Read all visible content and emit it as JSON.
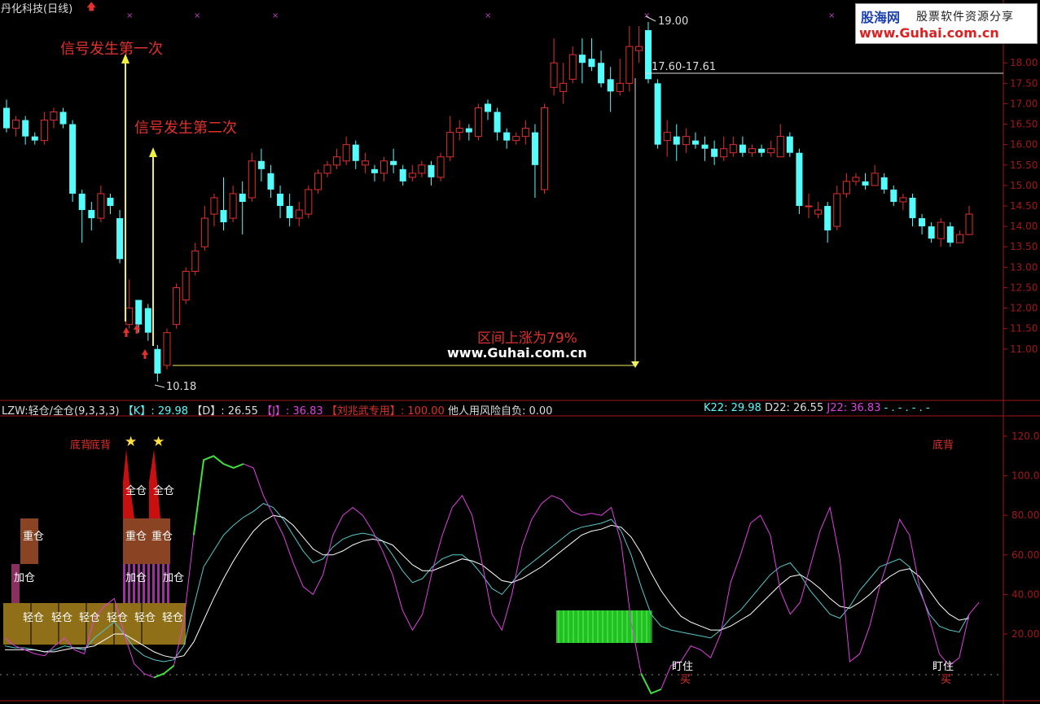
{
  "window": {
    "title": "丹化科技(日线)"
  },
  "logo": {
    "line1_brand": "股海网",
    "line1_text": "股票软件资源分享",
    "line2": "www.Guhai.com.cn"
  },
  "annotations": {
    "signal1": "信号发生第一次",
    "signal2": "信号发生第二次",
    "range_rise": "区间上涨为79%",
    "watermark": "www.Guhai.com.cn",
    "high_label": "19.00",
    "low_label": "10.18",
    "range_label": "17.60-17.61"
  },
  "indicator": {
    "name": "LZW:轻仓/全仓(9,3,3,3)",
    "k_label": "【K】",
    "k_value": ": 29.98",
    "d_label": "【D】",
    "d_value": ": 26.55",
    "j_label": "【J】",
    "j_value": ": 36.83",
    "liu_label": "【刘兆武专用】",
    "liu_value": ": 100.00",
    "risk": "他人用风险自负: 0.00",
    "k22": "K22: 29.98",
    "d22": "D22: 26.55",
    "j22": "J22: 36.83",
    "tail": "- . - . - . -"
  },
  "labels": {
    "bottom_divergence_left": "底背",
    "bottom_divergence_right": "底背",
    "star": "★",
    "full": "全仓",
    "heavy": "重仓",
    "add": "加仓",
    "light": "轻仓",
    "watch": "盯住",
    "buy": "买"
  },
  "colors": {
    "up": "#e0312c",
    "down": "#54fcfc",
    "axis": "#a01818",
    "k_line": "#54c8c8",
    "d_line": "#ffffff",
    "j_line": "#e040e0",
    "j_green": "#40e040",
    "light_block": "#8f7018",
    "heavy_block": "#8a4424",
    "full_spike": "#c81010",
    "green_block": "#20c020"
  },
  "chart_data": [
    {
      "type": "candlestick",
      "title": "丹化科技(日线)",
      "y_axis_ticks": [
        11.0,
        11.5,
        12.0,
        12.5,
        13.0,
        13.5,
        14.0,
        14.5,
        15.0,
        15.5,
        16.0,
        16.5,
        17.0,
        17.5,
        18.0
      ],
      "ylim": [
        10.2,
        19.1
      ],
      "candles": [
        [
          16.9,
          16.4,
          17.1,
          16.3
        ],
        [
          16.4,
          16.6,
          16.7,
          16.2
        ],
        [
          16.6,
          16.2,
          16.7,
          16.0
        ],
        [
          16.2,
          16.1,
          16.3,
          16.0
        ],
        [
          16.1,
          16.6,
          16.8,
          16.0
        ],
        [
          16.6,
          16.8,
          16.9,
          16.4
        ],
        [
          16.8,
          16.5,
          16.9,
          16.4
        ],
        [
          16.5,
          14.8,
          16.6,
          14.6
        ],
        [
          14.8,
          14.4,
          14.9,
          13.6
        ],
        [
          14.4,
          14.2,
          14.6,
          13.9
        ],
        [
          14.2,
          14.8,
          15.0,
          14.1
        ],
        [
          14.7,
          14.5,
          14.8,
          14.3
        ],
        [
          14.2,
          13.2,
          14.4,
          13.1
        ],
        [
          11.6,
          12.0,
          12.7,
          11.5
        ],
        [
          12.2,
          11.6,
          12.2,
          11.4
        ],
        [
          12.0,
          11.4,
          12.1,
          11.2
        ],
        [
          11.0,
          10.4,
          11.1,
          10.2
        ],
        [
          10.6,
          11.4,
          11.5,
          10.5
        ],
        [
          11.6,
          12.5,
          12.6,
          11.5
        ],
        [
          12.2,
          12.9,
          13.0,
          12.1
        ],
        [
          12.9,
          13.4,
          13.6,
          12.8
        ],
        [
          13.5,
          14.2,
          14.5,
          13.4
        ],
        [
          14.3,
          14.7,
          14.8,
          14.0
        ],
        [
          14.4,
          14.1,
          15.2,
          13.9
        ],
        [
          14.2,
          14.8,
          15.0,
          14.1
        ],
        [
          14.8,
          14.6,
          15.1,
          13.8
        ],
        [
          14.7,
          15.6,
          15.8,
          14.6
        ],
        [
          15.6,
          15.4,
          15.9,
          15.1
        ],
        [
          15.3,
          14.9,
          15.5,
          14.7
        ],
        [
          14.8,
          14.5,
          15.0,
          14.2
        ],
        [
          14.5,
          14.2,
          14.8,
          14.0
        ],
        [
          14.2,
          14.4,
          14.6,
          14.0
        ],
        [
          14.3,
          14.9,
          15.0,
          14.2
        ],
        [
          14.9,
          15.3,
          15.4,
          14.8
        ],
        [
          15.3,
          15.5,
          15.6,
          15.2
        ],
        [
          15.5,
          15.7,
          15.9,
          15.4
        ],
        [
          15.6,
          16.0,
          16.2,
          15.5
        ],
        [
          16.0,
          15.6,
          16.1,
          15.4
        ],
        [
          15.5,
          15.6,
          15.8,
          15.3
        ],
        [
          15.4,
          15.3,
          15.5,
          15.1
        ],
        [
          15.3,
          15.6,
          15.7,
          15.1
        ],
        [
          15.6,
          15.5,
          15.9,
          15.3
        ],
        [
          15.4,
          15.1,
          15.5,
          15.0
        ],
        [
          15.2,
          15.3,
          15.5,
          15.1
        ],
        [
          15.3,
          15.5,
          15.6,
          15.2
        ],
        [
          15.5,
          15.2,
          15.6,
          15.0
        ],
        [
          15.2,
          15.7,
          15.8,
          15.1
        ],
        [
          15.7,
          16.3,
          16.7,
          15.6
        ],
        [
          16.3,
          16.4,
          16.6,
          16.1
        ],
        [
          16.4,
          16.3,
          16.5,
          16.1
        ],
        [
          16.2,
          16.9,
          17.0,
          16.1
        ],
        [
          17.0,
          16.8,
          17.1,
          16.6
        ],
        [
          16.8,
          16.3,
          16.9,
          16.1
        ],
        [
          16.3,
          16.1,
          16.4,
          15.9
        ],
        [
          16.1,
          16.2,
          16.3,
          16.0
        ],
        [
          16.2,
          16.4,
          16.6,
          16.0
        ],
        [
          16.3,
          15.5,
          16.5,
          14.7
        ],
        [
          14.9,
          16.9,
          17.0,
          14.8
        ],
        [
          17.4,
          18.0,
          18.6,
          17.2
        ],
        [
          17.3,
          17.5,
          18.0,
          17.0
        ],
        [
          17.6,
          18.2,
          18.4,
          17.5
        ],
        [
          18.2,
          18.0,
          18.6,
          17.5
        ],
        [
          18.1,
          17.9,
          18.6,
          17.8
        ],
        [
          18.0,
          17.5,
          18.3,
          17.4
        ],
        [
          17.6,
          17.3,
          17.9,
          16.8
        ],
        [
          17.3,
          17.5,
          18.1,
          17.2
        ],
        [
          17.5,
          18.4,
          18.9,
          17.3
        ],
        [
          18.3,
          18.4,
          18.9,
          18.0
        ],
        [
          18.8,
          17.6,
          19.0,
          17.5
        ],
        [
          17.5,
          16.0,
          17.6,
          15.9
        ],
        [
          16.1,
          16.3,
          16.6,
          15.7
        ],
        [
          16.2,
          16.0,
          16.5,
          15.6
        ],
        [
          16.0,
          16.2,
          16.4,
          15.8
        ],
        [
          16.1,
          16.0,
          16.3,
          15.9
        ],
        [
          16.0,
          15.9,
          16.2,
          15.6
        ],
        [
          15.9,
          15.7,
          16.1,
          15.5
        ],
        [
          15.7,
          15.9,
          16.2,
          15.6
        ],
        [
          15.8,
          16.0,
          16.2,
          15.7
        ],
        [
          16.0,
          15.8,
          16.2,
          15.7
        ],
        [
          15.8,
          15.9,
          16.0,
          15.7
        ],
        [
          15.9,
          15.8,
          16.0,
          15.7
        ],
        [
          15.8,
          15.9,
          16.1,
          15.7
        ],
        [
          15.7,
          16.2,
          16.5,
          15.7
        ],
        [
          16.2,
          15.8,
          16.3,
          15.7
        ],
        [
          15.8,
          14.5,
          15.9,
          14.3
        ],
        [
          14.5,
          14.5,
          14.8,
          14.2
        ],
        [
          14.3,
          14.4,
          14.6,
          14.2
        ],
        [
          14.5,
          13.9,
          14.6,
          13.6
        ],
        [
          14.0,
          14.8,
          15.0,
          13.9
        ],
        [
          14.8,
          15.1,
          15.3,
          14.7
        ],
        [
          15.1,
          15.2,
          15.3,
          15.0
        ],
        [
          15.1,
          15.0,
          15.3,
          14.9
        ],
        [
          15.0,
          15.3,
          15.5,
          15.0
        ],
        [
          15.2,
          14.9,
          15.3,
          14.8
        ],
        [
          14.9,
          14.6,
          15.0,
          14.5
        ],
        [
          14.6,
          14.7,
          14.8,
          14.4
        ],
        [
          14.7,
          14.2,
          14.8,
          14.0
        ],
        [
          14.2,
          14.0,
          14.3,
          13.8
        ],
        [
          14.0,
          13.7,
          14.1,
          13.6
        ],
        [
          13.7,
          14.1,
          14.2,
          13.5
        ],
        [
          14.0,
          13.6,
          14.1,
          13.5
        ],
        [
          13.6,
          13.8,
          13.9,
          13.6
        ],
        [
          13.8,
          14.3,
          14.5,
          13.8
        ]
      ],
      "annotations": {
        "high": 19.0,
        "low": 10.18,
        "range": "17.60-17.61",
        "rise_pct": 79
      }
    },
    {
      "type": "line",
      "title": "LZW:轻仓/全仓(9,3,3,3)",
      "y_axis_ticks": [
        20,
        40,
        60,
        80,
        100,
        120
      ],
      "ylim": [
        -12,
        135
      ],
      "series": [
        {
          "name": "K",
          "values": [
            14,
            13,
            13,
            12,
            11,
            12,
            14,
            13,
            12,
            18,
            22,
            26,
            20,
            13,
            9,
            7,
            6,
            7,
            14,
            34,
            54,
            62,
            70,
            75,
            79,
            82,
            86,
            84,
            78,
            70,
            62,
            56,
            58,
            64,
            68,
            70,
            71,
            70,
            67,
            60,
            52,
            46,
            48,
            54,
            58,
            60,
            60,
            56,
            50,
            43,
            40,
            46,
            52,
            56,
            60,
            64,
            68,
            72,
            74,
            75,
            76,
            78,
            72,
            60,
            44,
            30,
            24,
            22,
            21,
            20,
            19,
            18,
            22,
            28,
            32,
            38,
            44,
            50,
            54,
            56,
            50,
            42,
            36,
            30,
            28,
            34,
            42,
            48,
            54,
            56,
            58,
            54,
            42,
            30,
            24,
            22,
            21,
            30
          ]
        },
        {
          "name": "D",
          "values": [
            12,
            12,
            12,
            12,
            11,
            11,
            12,
            13,
            13,
            14,
            17,
            20,
            20,
            17,
            14,
            11,
            9,
            8,
            9,
            16,
            27,
            38,
            48,
            57,
            65,
            72,
            77,
            80,
            79,
            75,
            69,
            63,
            60,
            60,
            62,
            65,
            67,
            68,
            67,
            65,
            60,
            55,
            52,
            52,
            54,
            56,
            58,
            57,
            55,
            51,
            47,
            46,
            48,
            51,
            54,
            58,
            62,
            66,
            70,
            72,
            73,
            75,
            74,
            69,
            61,
            51,
            42,
            35,
            29,
            26,
            24,
            22,
            22,
            24,
            27,
            30,
            35,
            40,
            45,
            49,
            50,
            47,
            43,
            38,
            34,
            33,
            36,
            40,
            45,
            49,
            52,
            53,
            49,
            42,
            35,
            30,
            27,
            28
          ]
        },
        {
          "name": "J",
          "values": [
            18,
            14,
            12,
            10,
            9,
            14,
            18,
            12,
            10,
            28,
            34,
            38,
            20,
            5,
            0,
            -2,
            0,
            4,
            26,
            70,
            108,
            110,
            106,
            104,
            106,
            104,
            90,
            80,
            70,
            56,
            44,
            40,
            50,
            70,
            80,
            84,
            80,
            72,
            62,
            50,
            32,
            22,
            30,
            52,
            70,
            84,
            90,
            80,
            56,
            30,
            22,
            40,
            64,
            78,
            86,
            90,
            88,
            82,
            80,
            81,
            80,
            84,
            66,
            26,
            0,
            -10,
            -8,
            4,
            6,
            14,
            12,
            8,
            20,
            46,
            60,
            76,
            80,
            70,
            42,
            30,
            36,
            54,
            72,
            84,
            58,
            6,
            10,
            24,
            44,
            60,
            78,
            70,
            44,
            28,
            10,
            4,
            8,
            30,
            36
          ]
        }
      ],
      "markers": [
        {
          "label": "底背",
          "position": "left"
        },
        {
          "label": "底背",
          "position": "right"
        },
        {
          "label": "全仓",
          "count": 2
        },
        {
          "label": "重仓"
        },
        {
          "label": "加仓"
        },
        {
          "label": "轻仓",
          "count": 6
        },
        {
          "label": "盯住"
        },
        {
          "label": "买"
        }
      ]
    }
  ]
}
